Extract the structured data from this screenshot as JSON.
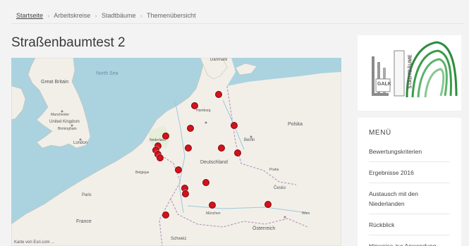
{
  "breadcrumb": {
    "items": [
      "Startseite",
      "Arbeitskreise",
      "Stadtbäume",
      "Themenübersicht"
    ],
    "separator": "›"
  },
  "page": {
    "title": "Straßenbaumtest 2"
  },
  "map": {
    "credit": "Karte von Esri.com ...",
    "labels": {
      "sea_north": "North Sea",
      "uk": "United Kingdom",
      "great_britain": "Great Britain",
      "denmark": "Danmark",
      "germany": "Deutschland",
      "belgium": "Belgique",
      "prague": "Praha",
      "austria": "Österreich",
      "poland": "Polska",
      "cesko": "Česko",
      "manchester": "Manchester",
      "birmingham": "Birmingham",
      "london": "London",
      "paris": "Paris",
      "berlin": "Berlin",
      "hamburg": "Hamburg",
      "muenchen": "München",
      "wien": "Wien",
      "nederland": "Nederland",
      "france": "France",
      "schweiz": "Schweiz"
    },
    "markers_count": 27
  },
  "logo": {
    "alt": "GALK Stadtbäume",
    "left_text": "GALK",
    "right_text": "STADTBÄUME"
  },
  "menu": {
    "heading": "MENÜ",
    "items": [
      "Bewertungskriterien",
      "Ergebnisse 2016",
      "Austausch mit den Niederlanden",
      "Rückblick",
      "Hinweise zur Anwendung"
    ]
  },
  "colors": {
    "marker": "#d4121a",
    "sea": "#aad3df",
    "land": "#f2efe9",
    "logo_green": "#2e8b3e"
  }
}
